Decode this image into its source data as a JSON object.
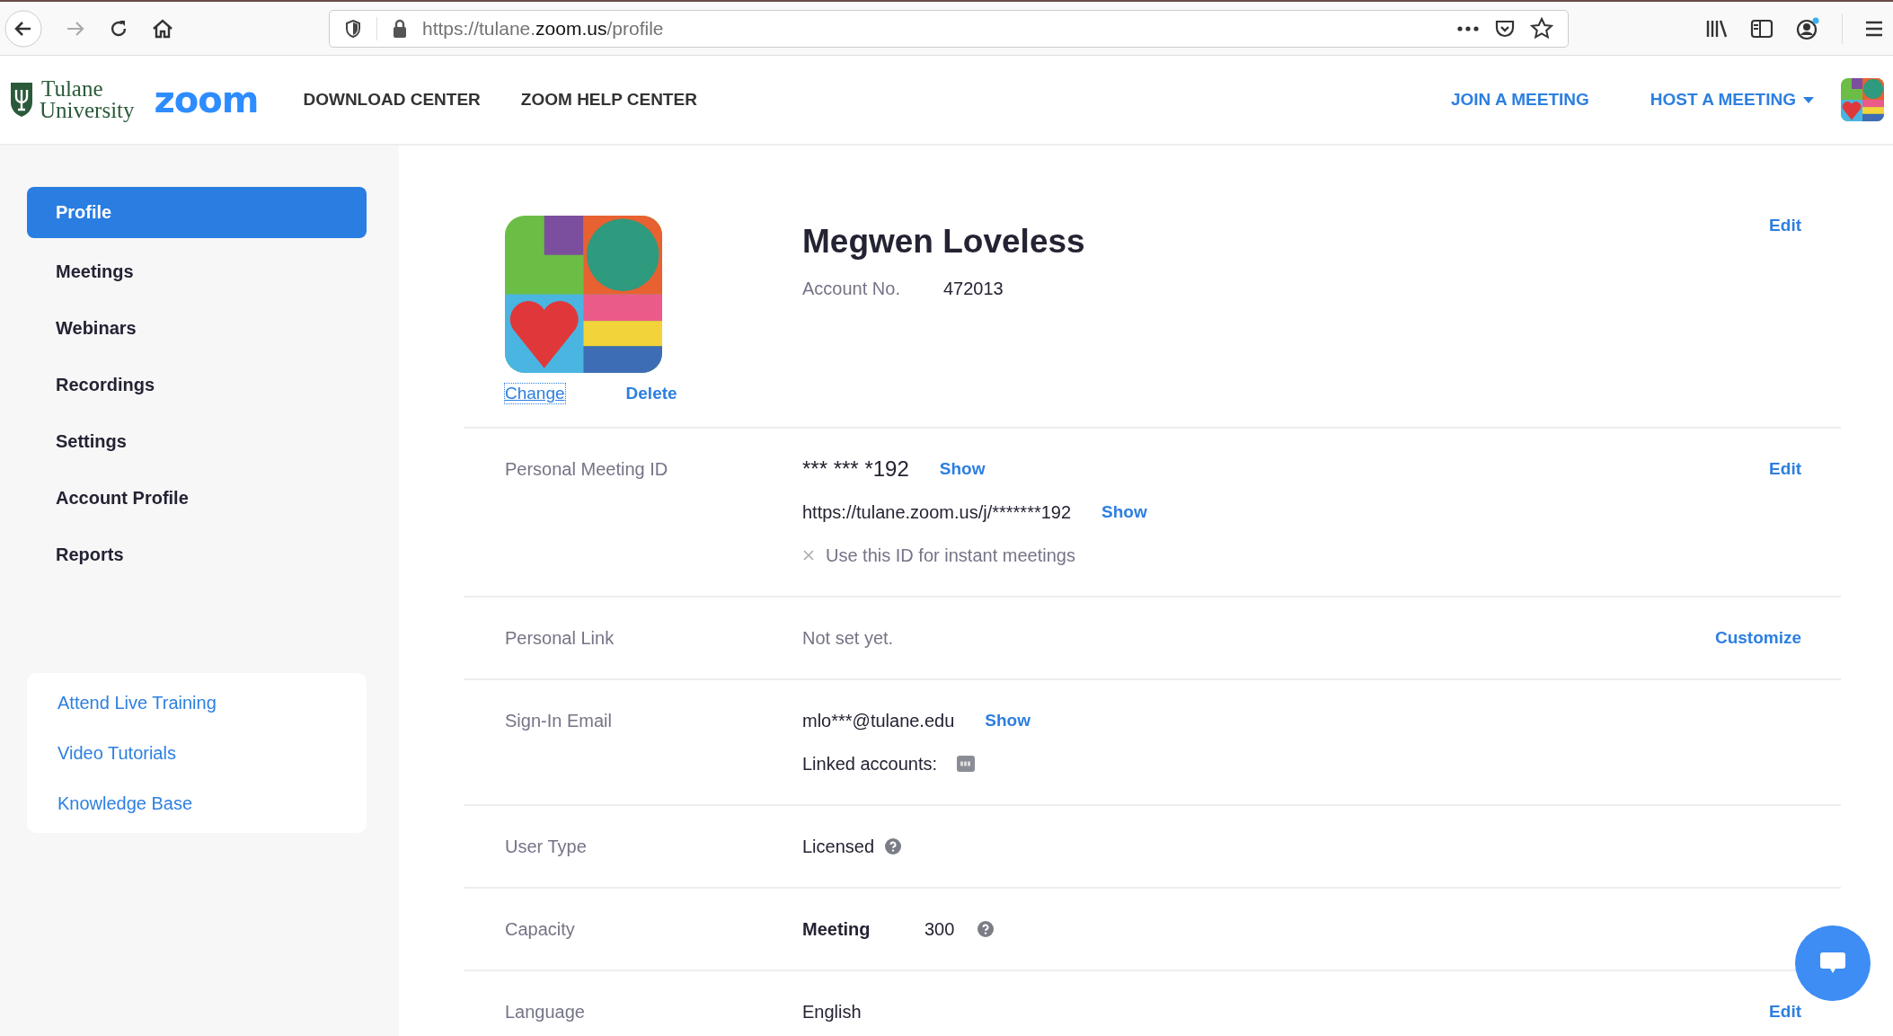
{
  "browser": {
    "url": "https://tulane.**zoom.us**/profile"
  },
  "header": {
    "logo_line1": "Tulane",
    "logo_line2": "University",
    "brand": "zoom",
    "nav": [
      "DOWNLOAD CENTER",
      "ZOOM HELP CENTER"
    ],
    "join": "JOIN A MEETING",
    "host": "HOST A MEETING"
  },
  "sidebar": {
    "items": [
      {
        "label": "Profile",
        "selected": true
      },
      {
        "label": "Meetings",
        "selected": false
      },
      {
        "label": "Webinars",
        "selected": false
      },
      {
        "label": "Recordings",
        "selected": false
      },
      {
        "label": "Settings",
        "selected": false
      },
      {
        "label": "Account Profile",
        "selected": false
      },
      {
        "label": "Reports",
        "selected": false
      }
    ],
    "help_links": [
      "Attend Live Training",
      "Video Tutorials",
      "Knowledge Base"
    ]
  },
  "profile": {
    "name": "Megwen Loveless",
    "account_label": "Account No.",
    "account_no": "472013",
    "change": "Change",
    "delete": "Delete",
    "edit": "Edit"
  },
  "rows": [
    {
      "label": "Personal Meeting ID",
      "action": "Edit",
      "lines": [
        {
          "kind": "masked",
          "text": "*** *** *192",
          "link": "Show"
        },
        {
          "kind": "plain",
          "text": "https://tulane.zoom.us/j/*******192",
          "link": "Show"
        },
        {
          "kind": "option",
          "text": "Use this ID for instant meetings",
          "checked": false
        }
      ]
    },
    {
      "label": "Personal Link",
      "action": "Customize",
      "lines": [
        {
          "kind": "muted",
          "text": "Not set yet."
        }
      ]
    },
    {
      "label": "Sign-In Email",
      "lines": [
        {
          "kind": "plain",
          "text": "mlo***@tulane.edu",
          "link": "Show"
        },
        {
          "kind": "linked",
          "text": "Linked accounts:"
        }
      ]
    },
    {
      "label": "User Type",
      "lines": [
        {
          "kind": "help",
          "text": "Licensed"
        }
      ]
    },
    {
      "label": "Capacity",
      "lines": [
        {
          "kind": "capacity",
          "label": "Meeting",
          "text": "300"
        }
      ]
    },
    {
      "label": "Language",
      "action": "Edit",
      "lines": [
        {
          "kind": "plain",
          "text": "English"
        }
      ]
    }
  ]
}
